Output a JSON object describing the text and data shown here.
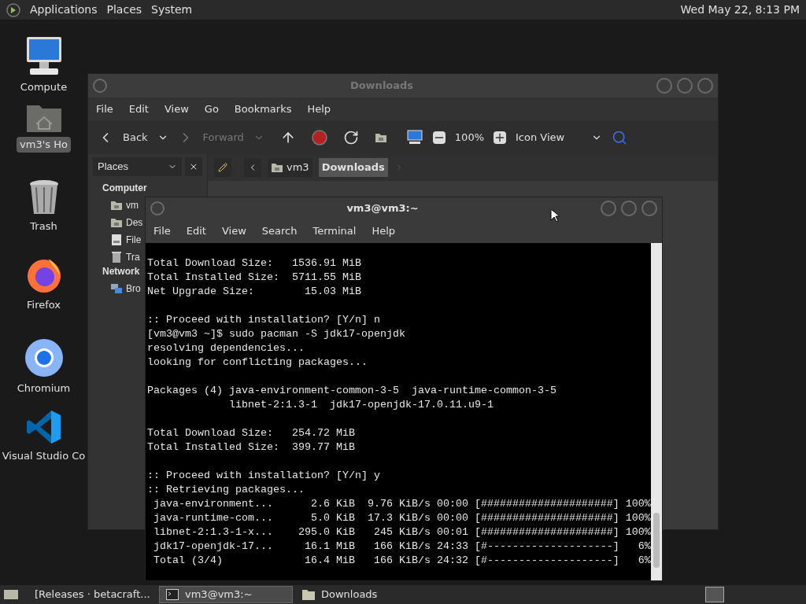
{
  "top_panel": {
    "menus": [
      "Applications",
      "Places",
      "System"
    ],
    "clock": "Wed May 22, 8:13 PM"
  },
  "desktop_icons": [
    {
      "label": "Compute",
      "kind": "computer",
      "selected": false
    },
    {
      "label": "vm3's Ho",
      "kind": "home",
      "selected": true
    },
    {
      "label": "Trash",
      "kind": "trash",
      "selected": false
    },
    {
      "label": "Firefox",
      "kind": "firefox",
      "selected": false
    },
    {
      "label": "Chromium",
      "kind": "chromium",
      "selected": false
    },
    {
      "label": "Visual Studio Co",
      "kind": "vscode",
      "selected": false
    }
  ],
  "file_manager": {
    "title": "Downloads",
    "menu": [
      "File",
      "Edit",
      "View",
      "Go",
      "Bookmarks",
      "Help"
    ],
    "back": {
      "label": "Back",
      "disabled": false
    },
    "forward": {
      "label": "Forward",
      "disabled": true
    },
    "zoom": "100%",
    "view": "Icon View",
    "path": [
      {
        "label": "vm3",
        "selected": false
      },
      {
        "label": "Downloads",
        "selected": true
      }
    ],
    "sidebar": {
      "selector": "Places",
      "sections": [
        {
          "heading": "Computer",
          "items": [
            {
              "label": "vm",
              "kind": "home"
            },
            {
              "label": "Des",
              "kind": "desktop"
            },
            {
              "label": "File",
              "kind": "drive"
            },
            {
              "label": "Tra",
              "kind": "trash"
            }
          ]
        },
        {
          "heading": "Network",
          "items": [
            {
              "label": "Bro",
              "kind": "network"
            }
          ]
        }
      ]
    }
  },
  "terminal": {
    "title": "vm3@vm3:~",
    "menu": [
      "File",
      "Edit",
      "View",
      "Search",
      "Terminal",
      "Help"
    ],
    "blocks": [
      [
        "Total Download Size:   1536.91 MiB",
        "Total Installed Size:  5711.55 MiB",
        "Net Upgrade Size:        15.03 MiB"
      ],
      [
        ":: Proceed with installation? [Y/n] n",
        "[vm3@vm3 ~]$ sudo pacman -S jdk17-openjdk",
        "resolving dependencies...",
        "looking for conflicting packages..."
      ],
      [
        "Packages (4) java-environment-common-3-5  java-runtime-common-3-5",
        "             libnet-2:1.3-1  jdk17-openjdk-17.0.11.u9-1"
      ],
      [
        "Total Download Size:   254.72 MiB",
        "Total Installed Size:  399.77 MiB"
      ],
      [
        ":: Proceed with installation? [Y/n] y",
        ":: Retrieving packages...",
        " java-environment...      2.6 KiB  9.76 KiB/s 00:00 [#####################] 100%",
        " java-runtime-com...      5.0 KiB  17.3 KiB/s 00:00 [#####################] 100%",
        " libnet-2:1.3-1-x...    295.0 KiB   245 KiB/s 00:01 [#####################] 100%",
        " jdk17-openjdk-17...     16.1 MiB   166 KiB/s 24:33 [#--------------------]   6%",
        " Total (3/4)             16.4 MiB   166 KiB/s 24:32 [#--------------------]   6%"
      ]
    ]
  },
  "taskbar": {
    "items": [
      {
        "label": "[Releases · betacraft...",
        "kind": "browser",
        "selected": false
      },
      {
        "label": "vm3@vm3:~",
        "kind": "terminal",
        "selected": true
      },
      {
        "label": "Downloads",
        "kind": "folder",
        "selected": false
      }
    ]
  }
}
